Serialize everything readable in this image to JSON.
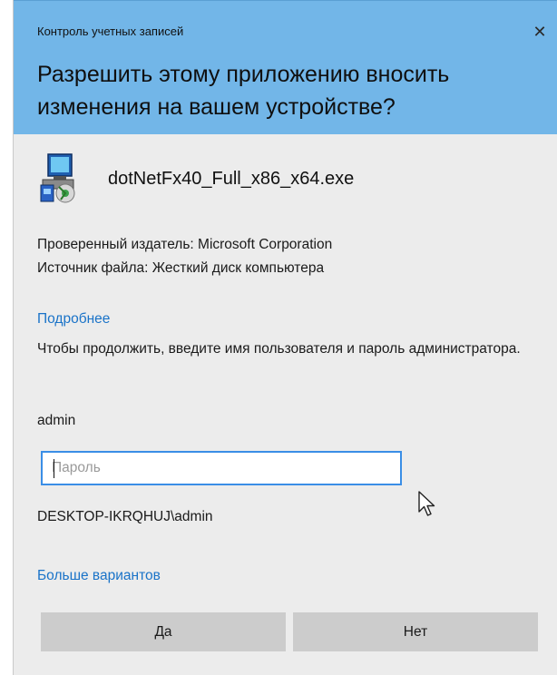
{
  "header": {
    "caption": "Контроль учетных записей",
    "title": "Разрешить этому приложению вносить изменения на вашем устройстве?",
    "close_glyph": "✕"
  },
  "app": {
    "name": "dotNetFx40_Full_x86_x64.exe",
    "icon": "installer-icon"
  },
  "details": {
    "publisher": "Проверенный издатель: Microsoft Corporation",
    "source": "Источник файла: Жесткий диск компьютера",
    "more_link": "Подробнее"
  },
  "prompt": "Чтобы продолжить, введите имя пользователя и пароль администратора.",
  "username": "admin",
  "password": {
    "value": "",
    "placeholder": "Пароль"
  },
  "account": "DESKTOP-IKRQHUJ\\admin",
  "more_options": "Больше вариантов",
  "buttons": {
    "yes": "Да",
    "no": "Нет"
  },
  "colors": {
    "header_bg": "#72b6e8",
    "body_bg": "#ececec",
    "link": "#1a73c8",
    "input_border": "#3a8ee6",
    "button_bg": "#cccccc"
  }
}
